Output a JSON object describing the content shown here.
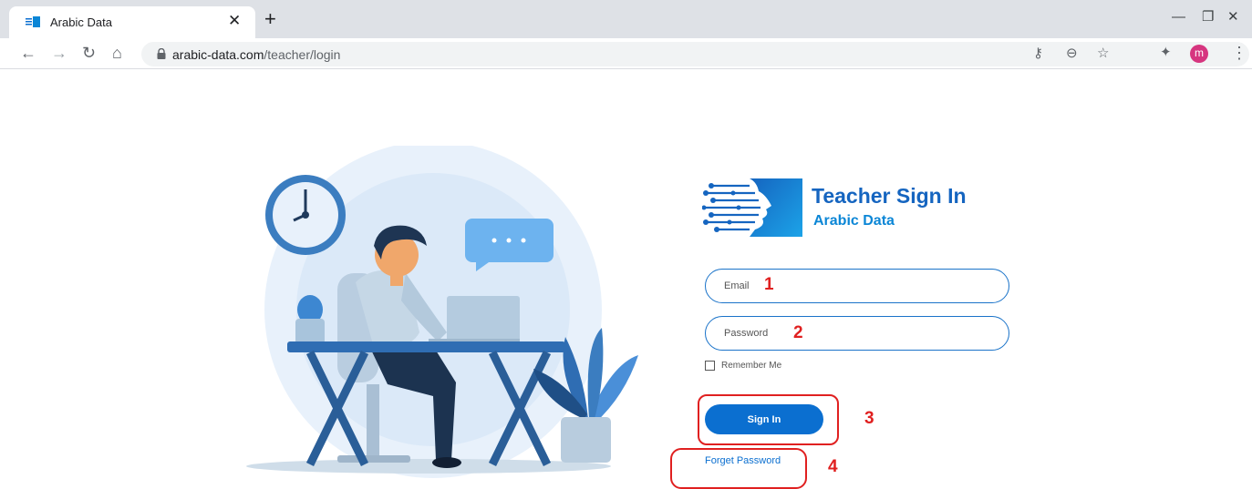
{
  "browser": {
    "tab_title": "Arabic Data",
    "tab_close_icon": "close-icon",
    "new_tab_icon": "plus-icon",
    "url_domain": "arabic-data.com",
    "url_path": "/teacher/login",
    "profile_initial": "m",
    "profile_color": "#d6357f"
  },
  "brand": {
    "title": "Teacher Sign In",
    "subtitle": "Arabic Data",
    "title_color": "#1565c0",
    "subtitle_color": "#0b86d6"
  },
  "form": {
    "email_placeholder": "Email",
    "password_placeholder": "Password",
    "remember_label": "Remember Me",
    "sign_in_label": "Sign In",
    "forget_label": "Forget Password"
  },
  "annotations": {
    "marker_1": "1",
    "marker_2": "2",
    "marker_3": "3",
    "marker_4": "4",
    "color": "#e02020"
  },
  "accent": "#0b6fd0"
}
